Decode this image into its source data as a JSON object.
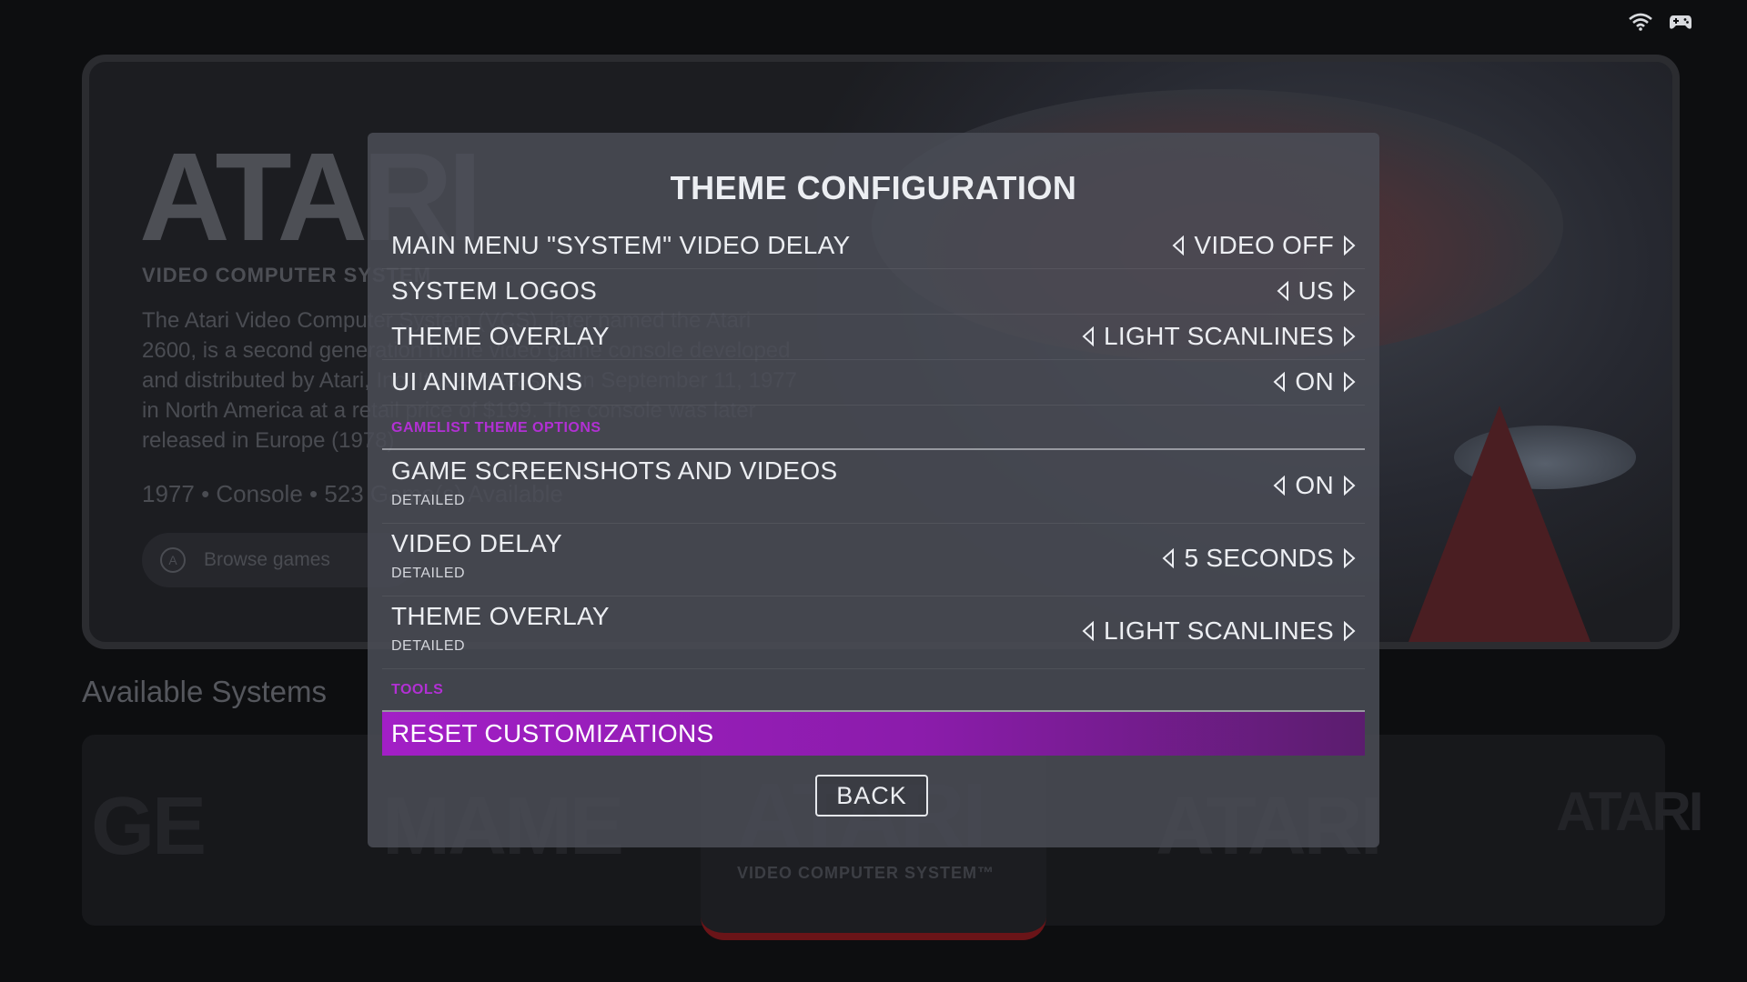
{
  "status": {
    "icons": [
      "wifi-icon",
      "gamepad-icon"
    ]
  },
  "background": {
    "logo_text": "ATARI",
    "logo_subtitle": "VIDEO COMPUTER SYSTEM",
    "description": "The Atari Video Computer System (VCS), later named the Atari 2600, is a second generation home video game console developed and distributed by Atari, Inc. It was released on September 11, 1977 in North America at a retail price of $199. The console was later released in Europe (1978)",
    "meta": "1977 • Console • 523 Game(s) Available",
    "browse_label": "Browse games",
    "browse_button_glyph": "A",
    "section_title": "Available Systems",
    "carousel_selected_subtitle": "VIDEO COMPUTER SYSTEM™"
  },
  "dialog": {
    "title": "THEME CONFIGURATION",
    "rows": [
      {
        "label": "MAIN MENU \"SYSTEM\" VIDEO DELAY",
        "value": "VIDEO OFF"
      },
      {
        "label": "SYSTEM LOGOS",
        "value": "US"
      },
      {
        "label": "THEME OVERLAY",
        "value": "LIGHT SCANLINES"
      },
      {
        "label": "UI ANIMATIONS",
        "value": "ON"
      }
    ],
    "gamelist_section": "GAMELIST THEME OPTIONS",
    "gamelist_rows": [
      {
        "label": "GAME SCREENSHOTS AND VIDEOS",
        "sublabel": "DETAILED",
        "value": "ON"
      },
      {
        "label": "VIDEO DELAY",
        "sublabel": "DETAILED",
        "value": "5 SECONDS"
      },
      {
        "label": "THEME OVERLAY",
        "sublabel": "DETAILED",
        "value": "LIGHT SCANLINES"
      }
    ],
    "tools_section": "TOOLS",
    "reset_label": "RESET CUSTOMIZATIONS",
    "back_label": "BACK"
  },
  "colors": {
    "accent": "#a21fc6",
    "section_header": "#b230d4",
    "dialog_bg": "#4a4d56"
  }
}
